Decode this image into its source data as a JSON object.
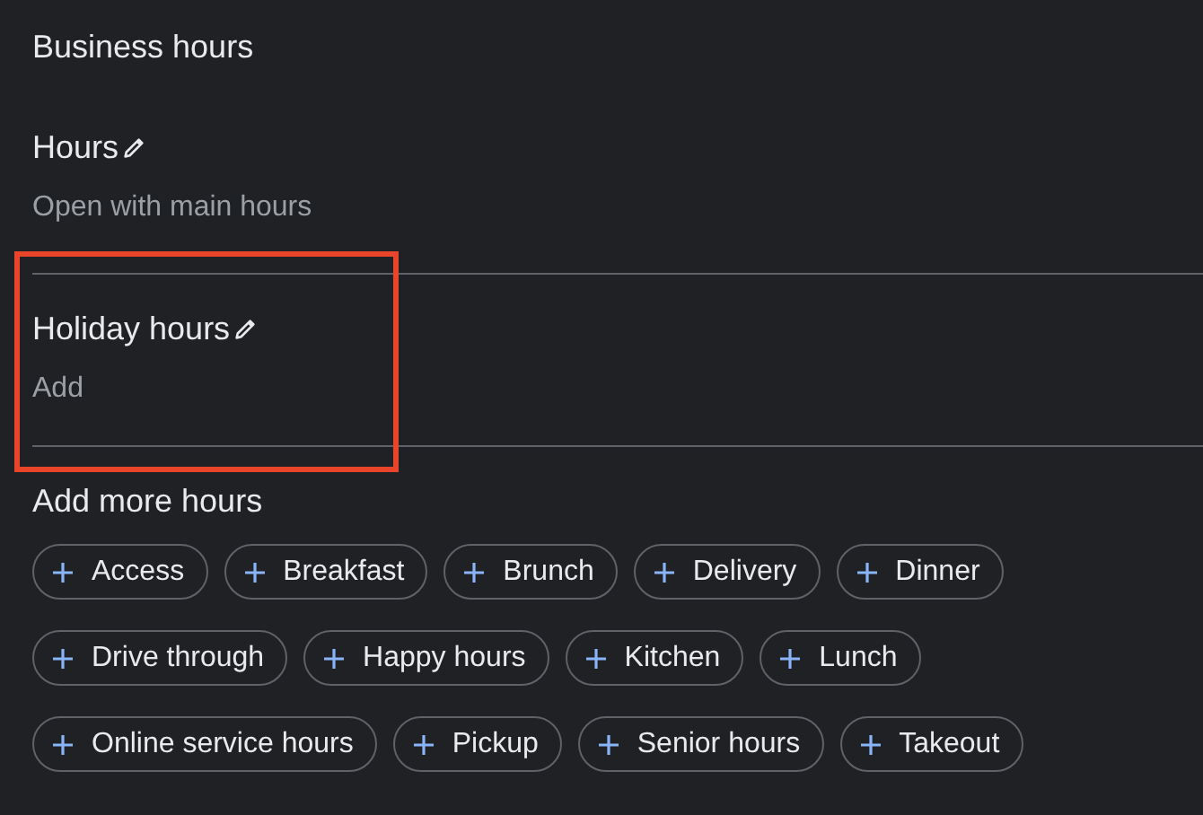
{
  "title": "Business hours",
  "sections": [
    {
      "label": "Hours",
      "value": "Open with main hours",
      "highlighted": false
    },
    {
      "label": "Holiday hours",
      "value": "Add",
      "highlighted": true
    }
  ],
  "more": {
    "heading": "Add more hours",
    "chip_rows": [
      [
        "Access",
        "Breakfast",
        "Brunch",
        "Delivery",
        "Dinner"
      ],
      [
        "Drive through",
        "Happy hours",
        "Kitchen",
        "Lunch"
      ],
      [
        "Online service hours",
        "Pickup",
        "Senior hours",
        "Takeout"
      ]
    ]
  }
}
